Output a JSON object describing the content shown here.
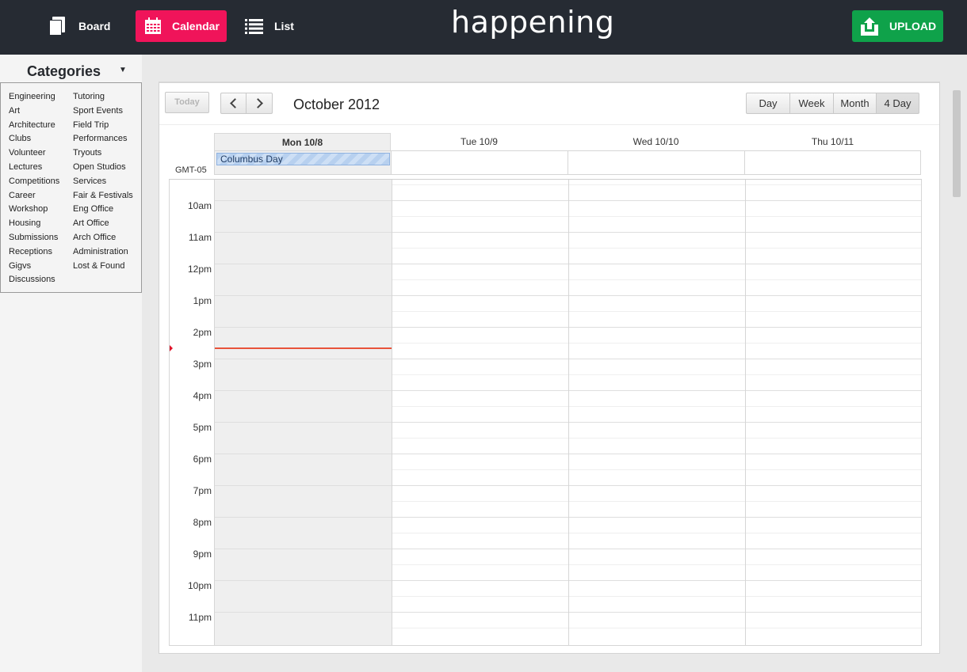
{
  "header": {
    "nav": {
      "board_label": "Board",
      "calendar_label": "Calendar",
      "list_label": "List"
    },
    "logo_text": "happening",
    "upload_label": "UPLOAD",
    "colors": {
      "bar": "#262b33",
      "calendar_active": "#f0145a",
      "upload": "#0fa24a"
    }
  },
  "sidebar": {
    "title": "Categories",
    "toggle_glyph": "▼",
    "column_1": [
      "Engineering",
      "Art",
      "Architecture",
      "Clubs",
      "Volunteer",
      "Lectures",
      "Competitions",
      "Career",
      "Workshop",
      "Housing",
      "Submissions",
      "Receptions",
      "Gigvs",
      "Discussions"
    ],
    "column_2": [
      "Tutoring",
      "Sport Events",
      "Field Trip",
      "Performances",
      "Tryouts",
      "Open Studios",
      "Services",
      "Fair & Festivals",
      "Eng Office",
      "Art Office",
      "Arch Office",
      "Administration",
      "Lost & Found"
    ]
  },
  "calendar": {
    "today_label": "Today",
    "title": "October 2012",
    "views": {
      "day": "Day",
      "week": "Week",
      "month": "Month",
      "four_day": "4 Day"
    },
    "active_view": "4 Day",
    "timezone_label": "GMT-05",
    "days": [
      "Mon 10/8",
      "Tue 10/9",
      "Wed 10/10",
      "Thu 10/11"
    ],
    "today_day": "Mon 10/8",
    "all_day_event": {
      "title": "Columbus Day",
      "day": "Mon 10/8"
    },
    "hours": [
      "10am",
      "11am",
      "12pm",
      "1pm",
      "2pm",
      "3pm",
      "4pm",
      "5pm",
      "6pm",
      "7pm",
      "8pm",
      "9pm",
      "10pm",
      "11pm"
    ]
  }
}
